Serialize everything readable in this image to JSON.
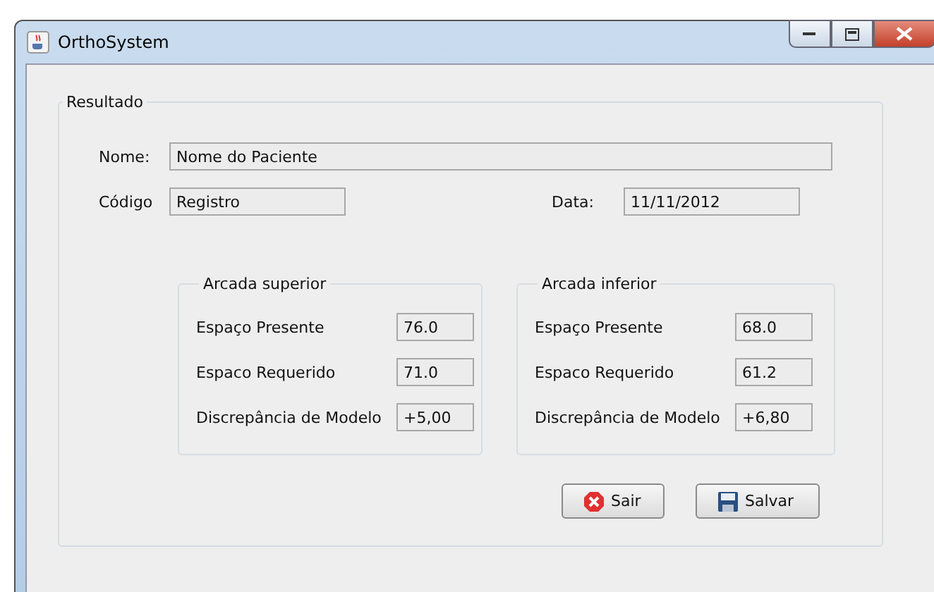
{
  "window": {
    "title": "OrthoSystem"
  },
  "group": {
    "title": "Resultado"
  },
  "name": {
    "label": "Nome:",
    "value": "Nome do Paciente"
  },
  "code": {
    "label": "Código",
    "value": "Registro"
  },
  "date": {
    "label": "Data:",
    "value": "11/11/2012"
  },
  "arcades": [
    {
      "title": "Arcada superior",
      "rows": [
        {
          "label": "Espaço Presente",
          "value": "76.0"
        },
        {
          "label": "Espaco Requerido",
          "value": "71.0"
        },
        {
          "label": "Discrepância de Modelo",
          "value": "+5,00"
        }
      ]
    },
    {
      "title": "Arcada inferior",
      "rows": [
        {
          "label": "Espaço Presente",
          "value": "68.0"
        },
        {
          "label": "Espaco Requerido",
          "value": "61.2"
        },
        {
          "label": "Discrepância de Modelo",
          "value": "+6,80"
        }
      ]
    }
  ],
  "buttons": [
    {
      "kind": "exit",
      "label": "Sair"
    },
    {
      "kind": "save",
      "label": "Salvar"
    }
  ]
}
